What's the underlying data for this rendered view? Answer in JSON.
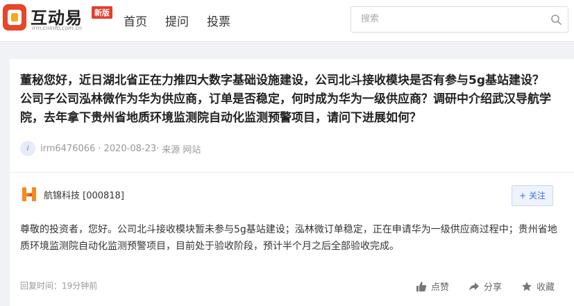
{
  "header": {
    "logo_text": "互动易",
    "logo_domain": "irm.cninfo.com.cn",
    "logo_badge": "新版",
    "nav": [
      "首页",
      "提问",
      "投票"
    ],
    "search_placeholder": "搜索"
  },
  "question": {
    "text": "董秘您好，近日湖北省正在力推四大数字基础设施建设，公司北斗接收模块是否有参与5g基站建设？公司子公司泓林微作为华为供应商，订单是否稳定，何时成为华为一级供应商？调研中介绍武汉导航学院，去年拿下贵州省地质环境监测院自动化监测预警项目，请问下进展如何？",
    "user": "irm6476066",
    "date": "· 2020-08-23·",
    "source": "来源 网站",
    "avatar_letter": "i"
  },
  "answer": {
    "company": "航锦科技 [000818]",
    "follow_label": "+ 关注",
    "text": "尊敬的投资者，您好。公司北斗接收模块暂未参与5g基站建设；泓林微订单稳定，正在申请华为一级供应商过程中；贵州省地质环境监测院自动化监测预警项目，目前处于验收阶段，预计半个月之后全部验收完成。",
    "reply_time": "回复时间：19分钟前",
    "actions": {
      "like": "点赞",
      "share": "分享",
      "favorite": "收藏"
    }
  },
  "colors": {
    "accent": "#3a6fd8",
    "brand_red": "#e63c2c",
    "background": "#f1f2f5"
  }
}
